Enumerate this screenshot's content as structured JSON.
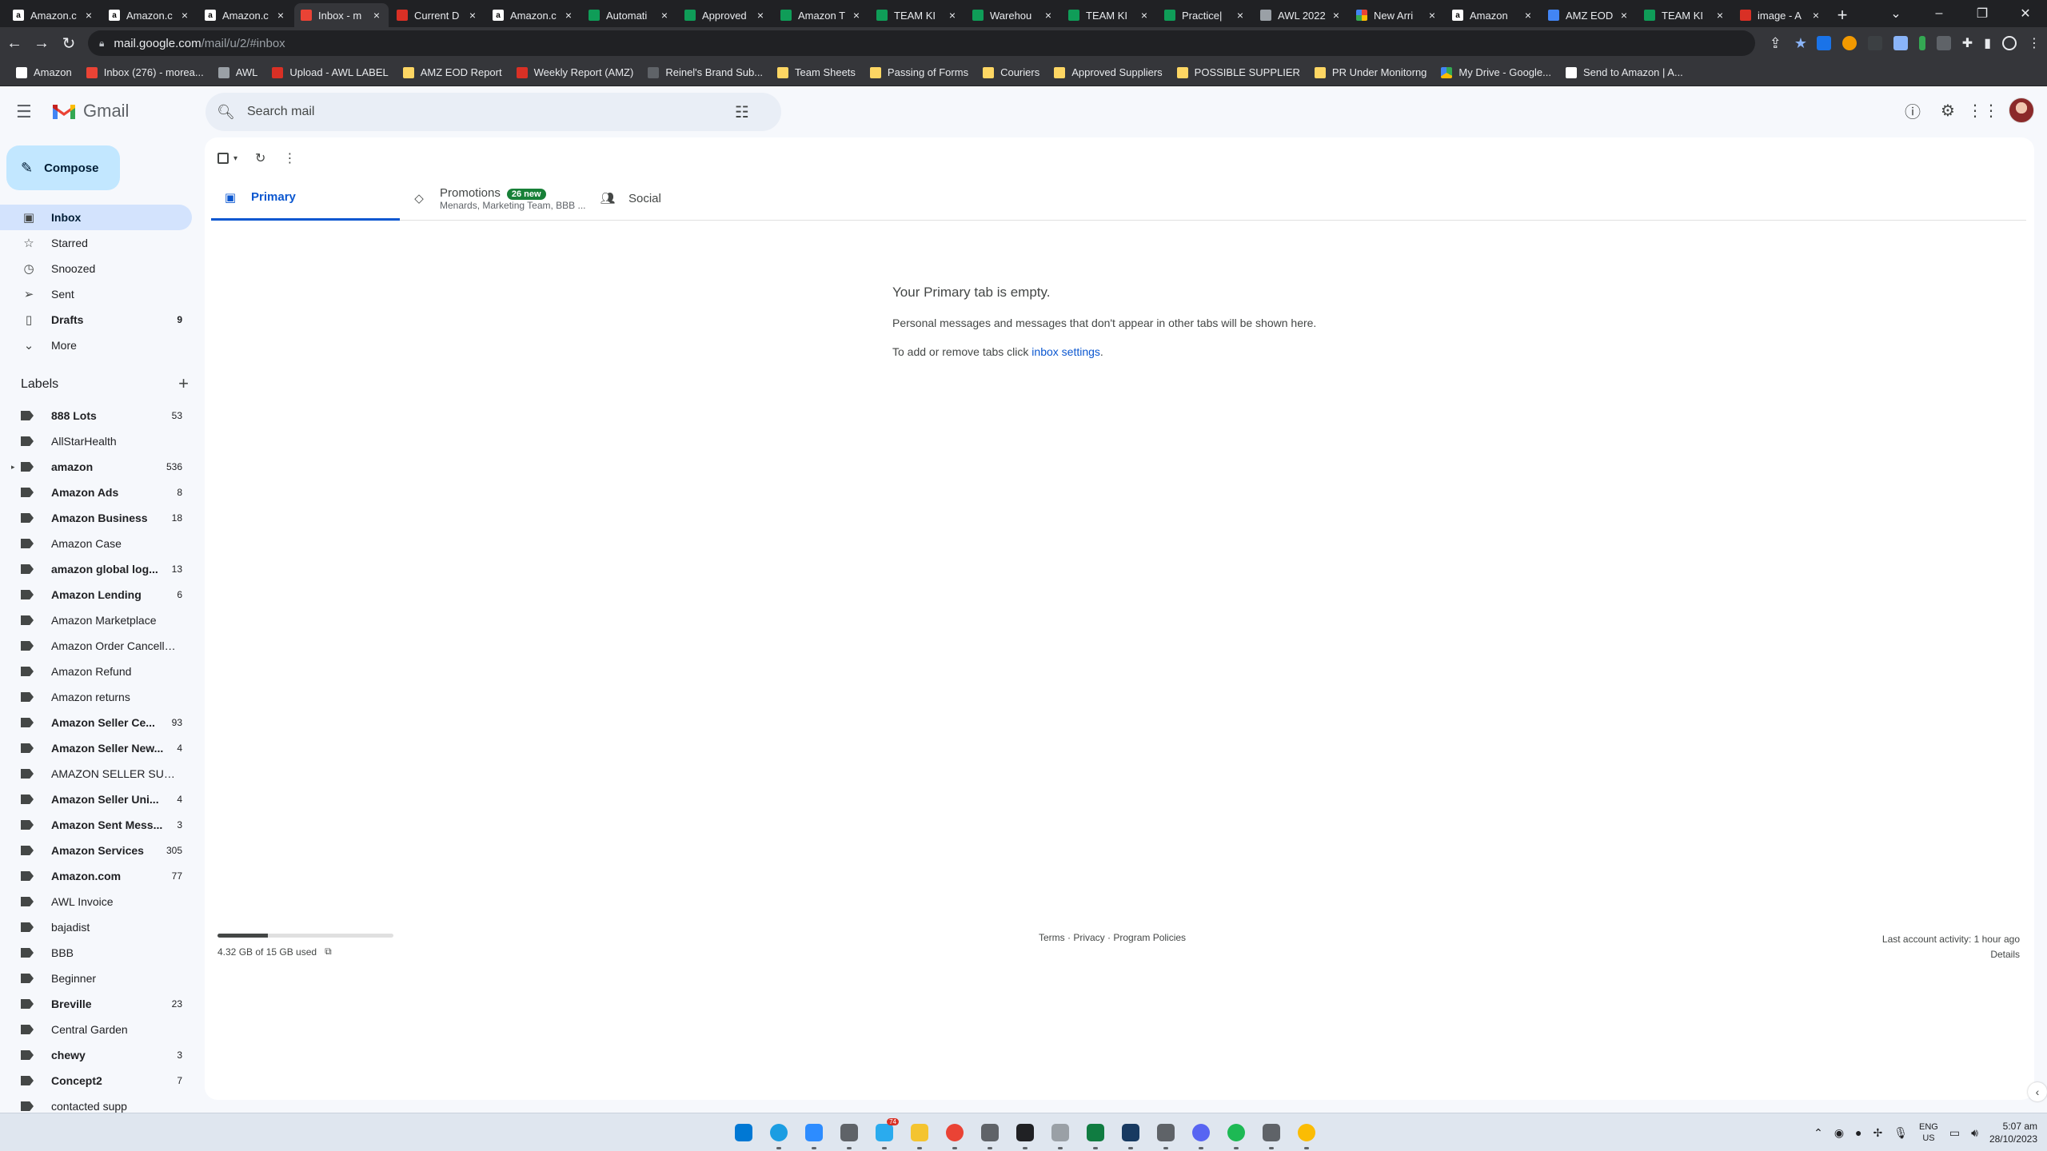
{
  "browser": {
    "tabs": [
      {
        "label": "Amazon.c",
        "favicon": "amazon"
      },
      {
        "label": "Amazon.c",
        "favicon": "amazon"
      },
      {
        "label": "Amazon.c",
        "favicon": "amazon"
      },
      {
        "label": "Inbox - m",
        "favicon": "gmail",
        "active": true
      },
      {
        "label": "Current D",
        "favicon": "red"
      },
      {
        "label": "Amazon.c",
        "favicon": "amazon"
      },
      {
        "label": "Automati",
        "favicon": "sheets"
      },
      {
        "label": "Approved",
        "favicon": "sheets"
      },
      {
        "label": "Amazon T",
        "favicon": "sheets"
      },
      {
        "label": "TEAM KI",
        "favicon": "sheets"
      },
      {
        "label": "Warehou",
        "favicon": "sheets"
      },
      {
        "label": "TEAM KI",
        "favicon": "sheets"
      },
      {
        "label": "Practice|",
        "favicon": "sheets"
      },
      {
        "label": "AWL 2022",
        "favicon": "grey"
      },
      {
        "label": "New Arri",
        "favicon": "multi"
      },
      {
        "label": "Amazon",
        "favicon": "amazon"
      },
      {
        "label": "AMZ EOD",
        "favicon": "drive"
      },
      {
        "label": "TEAM KI",
        "favicon": "sheets"
      },
      {
        "label": "image - A",
        "favicon": "red"
      }
    ],
    "url_host": "mail.google.com",
    "url_path": "/mail/u/2/#inbox",
    "bookmarks": [
      {
        "label": "Amazon",
        "icon": "amz"
      },
      {
        "label": "Inbox (276) - morea...",
        "icon": "gmail"
      },
      {
        "label": "AWL",
        "icon": "globe"
      },
      {
        "label": "Upload - AWL LABEL",
        "icon": "red"
      },
      {
        "label": "AMZ EOD Report",
        "icon": "folder"
      },
      {
        "label": "Weekly Report (AMZ)",
        "icon": "red"
      },
      {
        "label": "Reinel's Brand Sub...",
        "icon": "brand"
      },
      {
        "label": "Team Sheets",
        "icon": "folder"
      },
      {
        "label": "Passing of Forms",
        "icon": "folder"
      },
      {
        "label": "Couriers",
        "icon": "folder"
      },
      {
        "label": "Approved Suppliers",
        "icon": "folder"
      },
      {
        "label": "POSSIBLE SUPPLIER",
        "icon": "folder"
      },
      {
        "label": "PR Under Monitorng",
        "icon": "folder"
      },
      {
        "label": "My Drive - Google...",
        "icon": "drive"
      },
      {
        "label": "Send to Amazon | A...",
        "icon": "amz"
      }
    ]
  },
  "gmail": {
    "logo_text": "Gmail",
    "search_placeholder": "Search mail",
    "compose_label": "Compose",
    "nav": [
      {
        "label": "Inbox",
        "icon": "inbox-icon",
        "count": "",
        "active": true
      },
      {
        "label": "Starred",
        "icon": "star-icon",
        "count": ""
      },
      {
        "label": "Snoozed",
        "icon": "clock-icon",
        "count": ""
      },
      {
        "label": "Sent",
        "icon": "send-icon",
        "count": ""
      },
      {
        "label": "Drafts",
        "icon": "draft-icon",
        "count": "9",
        "bold": true
      },
      {
        "label": "More",
        "icon": "chevron-down-icon",
        "count": ""
      }
    ],
    "labels_title": "Labels",
    "labels": [
      {
        "name": "888 Lots",
        "count": "53",
        "bold": true
      },
      {
        "name": "AllStarHealth",
        "count": ""
      },
      {
        "name": "amazon",
        "count": "536",
        "bold": true,
        "expandable": true
      },
      {
        "name": "Amazon Ads",
        "count": "8",
        "bold": true
      },
      {
        "name": "Amazon Business",
        "count": "18",
        "bold": true
      },
      {
        "name": "Amazon Case",
        "count": ""
      },
      {
        "name": "amazon global log...",
        "count": "13",
        "bold": true
      },
      {
        "name": "Amazon Lending",
        "count": "6",
        "bold": true
      },
      {
        "name": "Amazon Marketplace",
        "count": ""
      },
      {
        "name": "Amazon Order Cancella...",
        "count": ""
      },
      {
        "name": "Amazon Refund",
        "count": ""
      },
      {
        "name": "Amazon returns",
        "count": ""
      },
      {
        "name": "Amazon Seller Ce...",
        "count": "93",
        "bold": true
      },
      {
        "name": "Amazon Seller New...",
        "count": "4",
        "bold": true
      },
      {
        "name": "AMAZON SELLER SUPP...",
        "count": ""
      },
      {
        "name": "Amazon Seller Uni...",
        "count": "4",
        "bold": true
      },
      {
        "name": "Amazon Sent Mess...",
        "count": "3",
        "bold": true
      },
      {
        "name": "Amazon Services",
        "count": "305",
        "bold": true
      },
      {
        "name": "Amazon.com",
        "count": "77",
        "bold": true
      },
      {
        "name": "AWL Invoice",
        "count": ""
      },
      {
        "name": "bajadist",
        "count": ""
      },
      {
        "name": "BBB",
        "count": ""
      },
      {
        "name": "Beginner",
        "count": ""
      },
      {
        "name": "Breville",
        "count": "23",
        "bold": true
      },
      {
        "name": "Central Garden",
        "count": ""
      },
      {
        "name": "chewy",
        "count": "3",
        "bold": true
      },
      {
        "name": "Concept2",
        "count": "7",
        "bold": true
      },
      {
        "name": "contacted supp",
        "count": ""
      }
    ],
    "tabs": [
      {
        "label": "Primary",
        "icon": "inbox-icon",
        "active": true,
        "subtitle": "",
        "badge": ""
      },
      {
        "label": "Promotions",
        "icon": "tag-icon",
        "subtitle": "Menards, Marketing Team, BBB ...",
        "badge": "26 new"
      },
      {
        "label": "Social",
        "icon": "people-icon",
        "subtitle": "",
        "badge": ""
      }
    ],
    "empty": {
      "title": "Your Primary tab is empty.",
      "line1": "Personal messages and messages that don't appear in other tabs will be shown here.",
      "line2_prefix": "To add or remove tabs click ",
      "line2_link": "inbox settings",
      "line2_suffix": "."
    },
    "storage": {
      "text": "4.32 GB of 15 GB used",
      "fraction": 0.288
    },
    "footer": {
      "terms": "Terms",
      "privacy": "Privacy",
      "policies": "Program Policies",
      "sep": " · "
    },
    "activity": {
      "text": "Last account activity: 1 hour ago",
      "details": "Details"
    }
  },
  "taskbar": {
    "apps": [
      {
        "name": "windows-start",
        "color": "#0078d4"
      },
      {
        "name": "edge",
        "color": "#1b9de2"
      },
      {
        "name": "zoom",
        "color": "#2d8cff"
      },
      {
        "name": "calculator",
        "color": "#5f6368"
      },
      {
        "name": "telegram",
        "color": "#2aabee",
        "notif": "74"
      },
      {
        "name": "file-explorer",
        "color": "#f4c430"
      },
      {
        "name": "chrome",
        "color": "#ea4335"
      },
      {
        "name": "settings",
        "color": "#5f6368"
      },
      {
        "name": "app-g",
        "color": "#202124"
      },
      {
        "name": "app-plus",
        "color": "#9aa0a6"
      },
      {
        "name": "app-green",
        "color": "#107c41"
      },
      {
        "name": "virtualbox",
        "color": "#183a61"
      },
      {
        "name": "app-check",
        "color": "#5f6368"
      },
      {
        "name": "discord",
        "color": "#5865f2"
      },
      {
        "name": "spotify",
        "color": "#1db954"
      },
      {
        "name": "app-window",
        "color": "#5f6368"
      },
      {
        "name": "chrome-active",
        "color": "#fbbc04"
      }
    ],
    "lang_top": "ENG",
    "lang_bottom": "US",
    "time": "5:07 am",
    "date": "28/10/2023"
  }
}
